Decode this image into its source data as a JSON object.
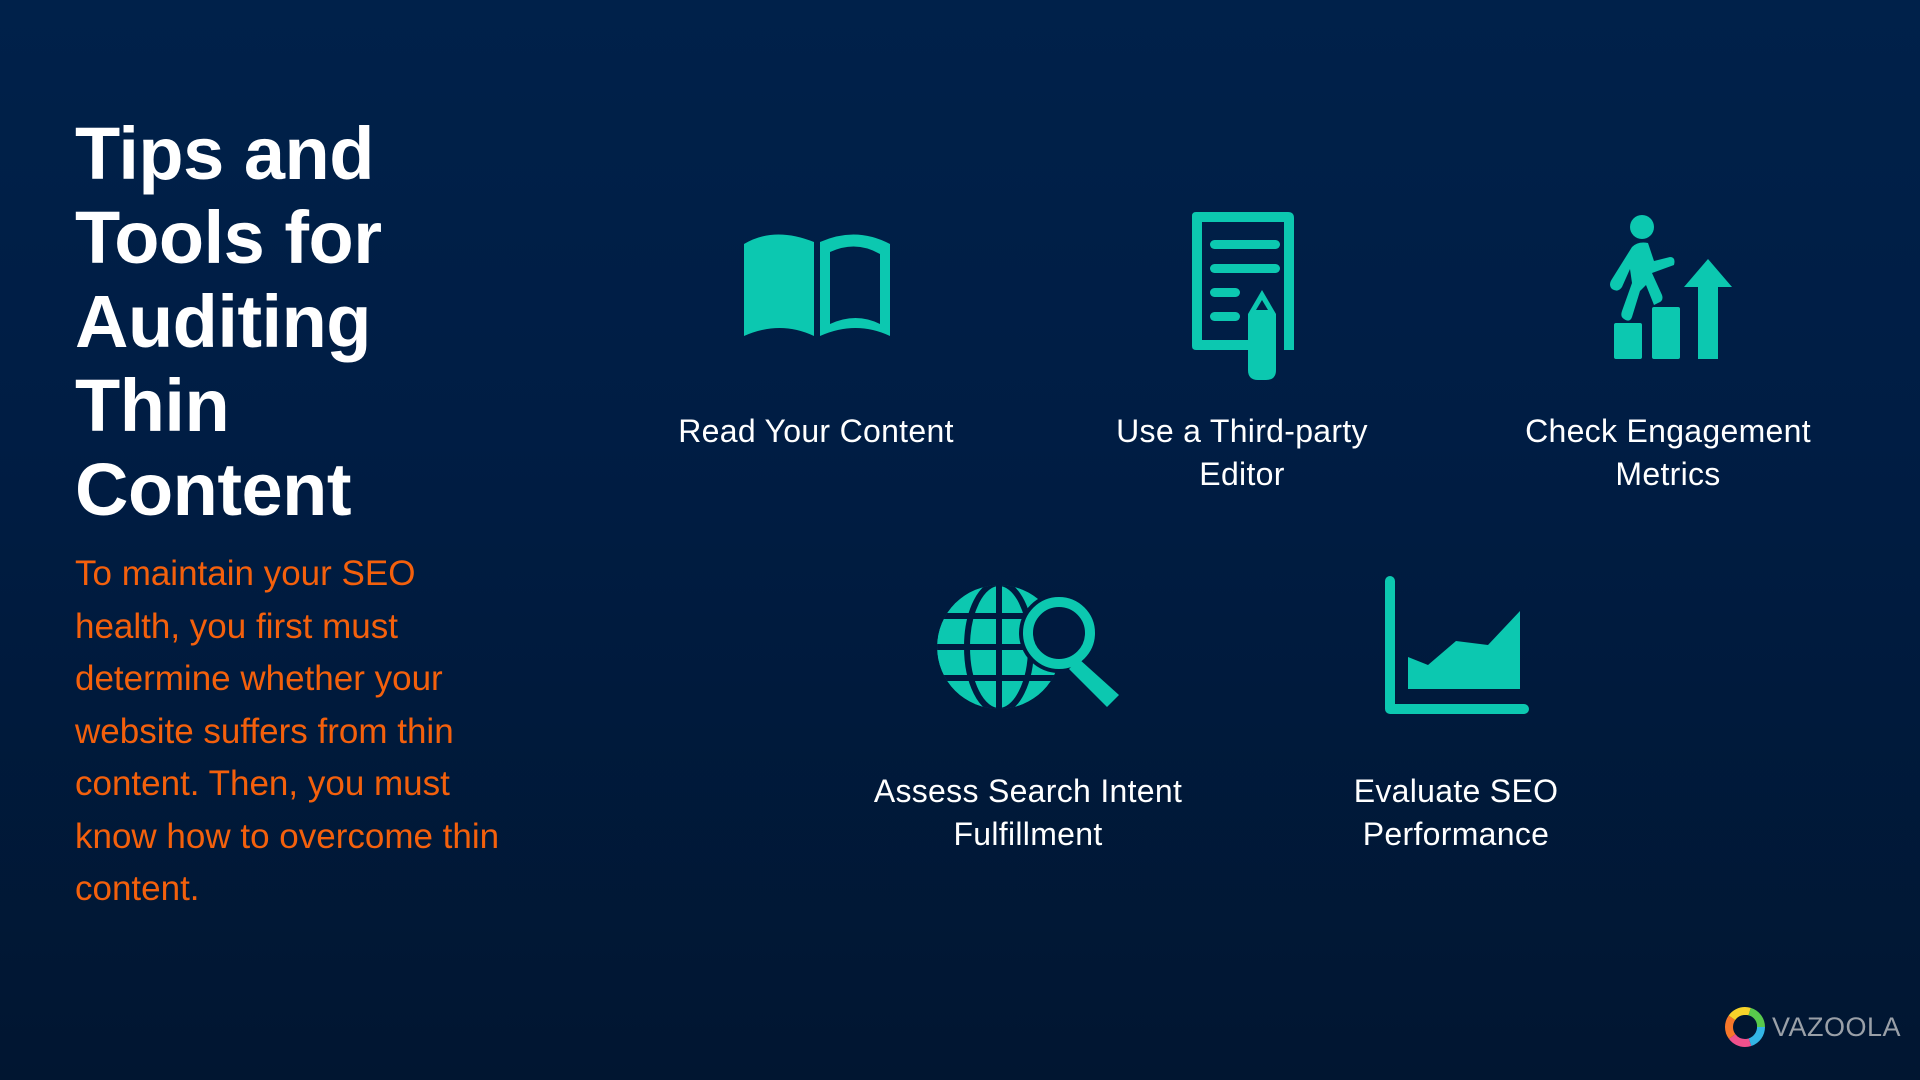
{
  "title": "Tips and Tools for Auditing Thin Content",
  "description": "To maintain your SEO health, you first must determine whether your website suffers from thin content. Then, you must know how to overcome thin content.",
  "colors": {
    "accent": "#0cc8b0",
    "description_text": "#f4600c",
    "background_top": "#00214a",
    "background_bottom": "#011631",
    "label_text": "#ffffff"
  },
  "tips": [
    {
      "icon": "open-book-icon",
      "label_lines": [
        "Read Your Content"
      ]
    },
    {
      "icon": "document-pencil-icon",
      "label_lines": [
        "Use a Third-party",
        "Editor"
      ]
    },
    {
      "icon": "person-climbing-bars-icon",
      "label_lines": [
        "Check Engagement",
        "Metrics"
      ]
    },
    {
      "icon": "globe-search-icon",
      "label_lines": [
        "Assess Search Intent",
        "Fulfillment"
      ]
    },
    {
      "icon": "area-chart-icon",
      "label_lines": [
        "Evaluate SEO",
        "Performance"
      ]
    }
  ],
  "logo": {
    "text": "VAZOOLA"
  }
}
